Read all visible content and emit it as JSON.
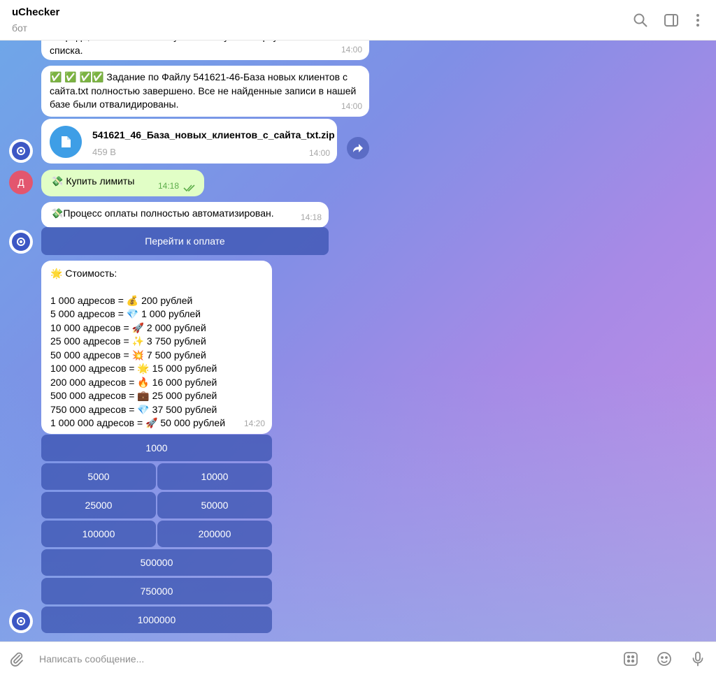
{
  "header": {
    "title": "uChecker",
    "subtitle": "бот"
  },
  "messages": {
    "m1": {
      "text": "очереди, в ближайшие минуты вы получите первую часть списка.",
      "time": "14:00"
    },
    "m2": {
      "text": "✅ ✅ ✅✅ Задание по Файлу 541621-46-База новых клиентов с сайта.txt полностью завершено. Все не найденные записи в нашей базе были отвалидированы.",
      "time": "14:00"
    },
    "file": {
      "name": "541621_46_База_новых_клиентов_с_сайта_txt.zip",
      "size": "459 B",
      "time": "14:00"
    },
    "user": {
      "avatar_letter": "Д",
      "text": "💸 Купить лимиты",
      "time": "14:18"
    },
    "payment": {
      "text": "💸Процесс оплаты полностью автоматизирован.",
      "time": "14:18",
      "button": "Перейти к оплате"
    },
    "prices": {
      "heading": "🌟 Стоимость:",
      "lines": [
        "1 000 адресов = 💰 200 рублей",
        "5 000 адресов = 💎 1 000 рублей",
        "10 000 адресов = 🚀 2 000 рублей",
        "25 000 адресов = ✨ 3 750 рублей",
        "50 000 адресов = 💥 7 500 рублей",
        "100 000 адресов = 🌟 15 000 рублей",
        "200 000 адресов = 🔥 16 000 рублей",
        "500 000 адресов = 💼 25 000 рублей",
        "750 000 адресов = 💎 37 500 рублей",
        "1 000 000 адресов = 🚀 50 000 рублей"
      ],
      "time": "14:20"
    }
  },
  "keyboard": {
    "b1000": "1000",
    "b5000": "5000",
    "b10000": "10000",
    "b25000": "25000",
    "b50000": "50000",
    "b100000": "100000",
    "b200000": "200000",
    "b500000": "500000",
    "b750000": "750000",
    "b1000000": "1000000"
  },
  "composer": {
    "placeholder": "Написать сообщение..."
  }
}
